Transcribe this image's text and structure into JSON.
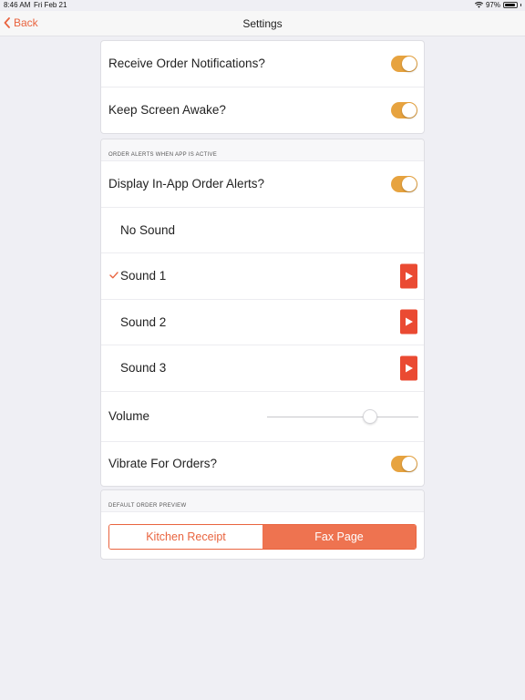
{
  "status_bar": {
    "time": "8:46 AM",
    "date": "Fri Feb 21",
    "battery": "97%",
    "wifi_icon": "wifi-icon"
  },
  "nav": {
    "back_label": "Back",
    "title": "Settings"
  },
  "notifications": {
    "receive_label": "Receive Order Notifications?",
    "receive_on": true,
    "awake_label": "Keep Screen Awake?",
    "awake_on": true
  },
  "alerts": {
    "header": "ORDER ALERTS WHEN APP IS ACTIVE",
    "display_label": "Display In-App Order Alerts?",
    "display_on": true,
    "sounds": [
      {
        "label": "No Sound",
        "selected": false,
        "playable": false
      },
      {
        "label": "Sound 1",
        "selected": true,
        "playable": true
      },
      {
        "label": "Sound 2",
        "selected": false,
        "playable": true
      },
      {
        "label": "Sound 3",
        "selected": false,
        "playable": true
      }
    ],
    "volume_label": "Volume",
    "volume_value": 0.68,
    "vibrate_label": "Vibrate For Orders?",
    "vibrate_on": true
  },
  "preview": {
    "header": "DEFAULT ORDER PREVIEW",
    "options": [
      "Kitchen Receipt",
      "Fax Page"
    ],
    "selected": "Fax Page"
  },
  "colors": {
    "accent": "#e9643f",
    "toggle_on": "#e7a33f",
    "play_button": "#ea4a32",
    "segment_active": "#ee7350"
  }
}
